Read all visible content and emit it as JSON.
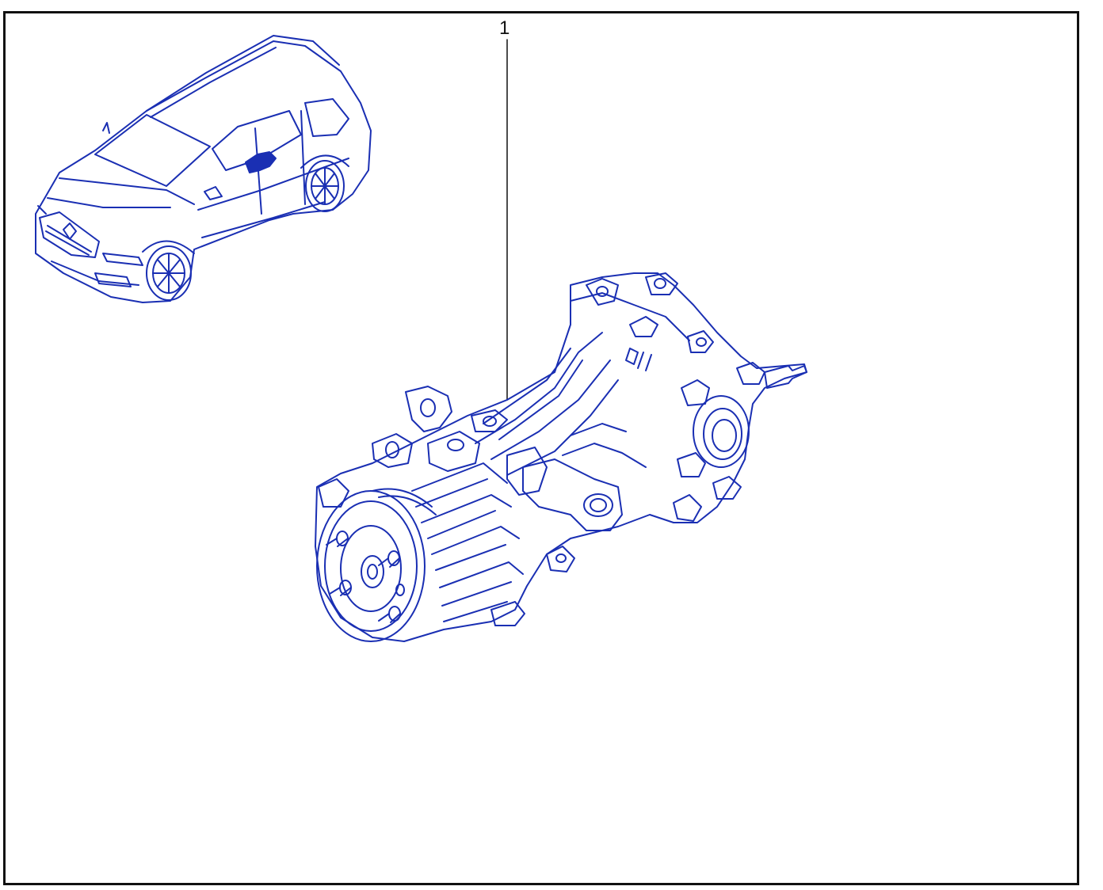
{
  "diagram": {
    "line_color": "#1a2fb3",
    "frame_color": "#111111",
    "callouts": [
      {
        "label": "1"
      }
    ],
    "parts": [
      {
        "icon": "suv-vehicle-illustration"
      },
      {
        "icon": "rear-differential-drive-unit-illustration"
      }
    ]
  }
}
